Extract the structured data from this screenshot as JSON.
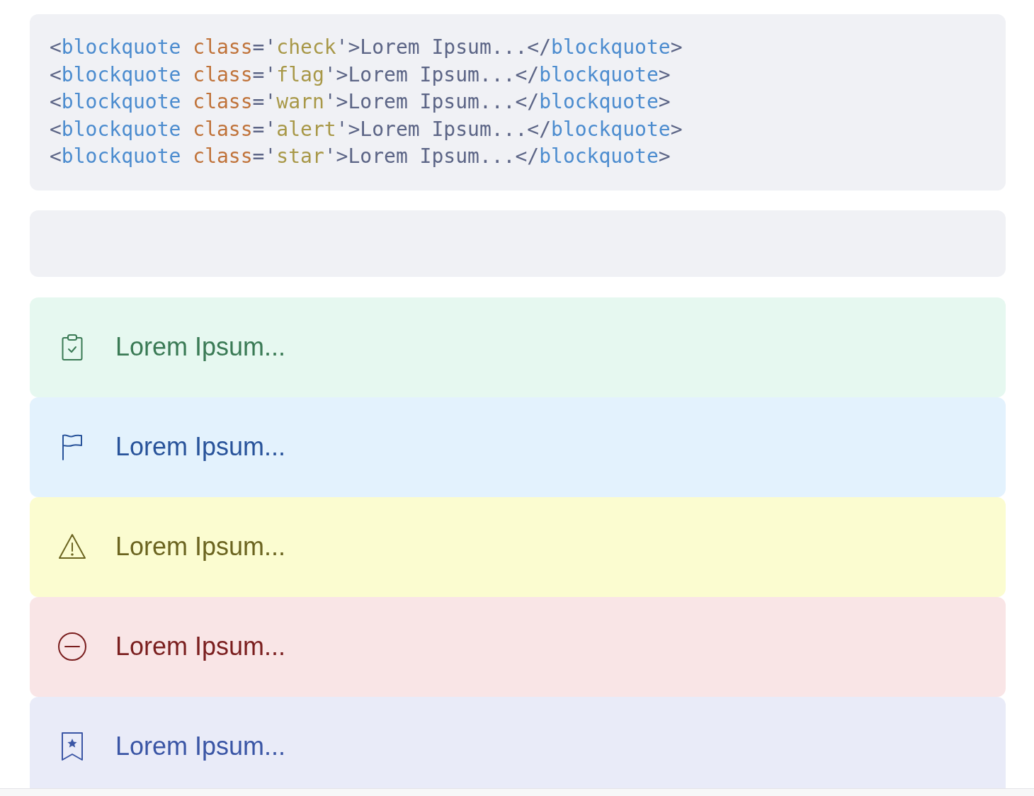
{
  "code_block": {
    "lines": [
      [
        {
          "kind": "punct",
          "text": "<"
        },
        {
          "kind": "tag",
          "text": "blockquote"
        },
        {
          "kind": "attr",
          "text": " class"
        },
        {
          "kind": "punct",
          "text": "='"
        },
        {
          "kind": "value",
          "text": "check"
        },
        {
          "kind": "punct",
          "text": "'>Lorem Ipsum...</"
        },
        {
          "kind": "tag",
          "text": "blockquote"
        },
        {
          "kind": "punct",
          "text": ">"
        }
      ],
      [
        {
          "kind": "punct",
          "text": "<"
        },
        {
          "kind": "tag",
          "text": "blockquote"
        },
        {
          "kind": "attr",
          "text": " class"
        },
        {
          "kind": "punct",
          "text": "='"
        },
        {
          "kind": "value",
          "text": "flag"
        },
        {
          "kind": "punct",
          "text": "'>Lorem Ipsum...</"
        },
        {
          "kind": "tag",
          "text": "blockquote"
        },
        {
          "kind": "punct",
          "text": ">"
        }
      ],
      [
        {
          "kind": "punct",
          "text": "<"
        },
        {
          "kind": "tag",
          "text": "blockquote"
        },
        {
          "kind": "attr",
          "text": " class"
        },
        {
          "kind": "punct",
          "text": "='"
        },
        {
          "kind": "value",
          "text": "warn"
        },
        {
          "kind": "punct",
          "text": "'>Lorem Ipsum...</"
        },
        {
          "kind": "tag",
          "text": "blockquote"
        },
        {
          "kind": "punct",
          "text": ">"
        }
      ],
      [
        {
          "kind": "punct",
          "text": "<"
        },
        {
          "kind": "tag",
          "text": "blockquote"
        },
        {
          "kind": "attr",
          "text": " class"
        },
        {
          "kind": "punct",
          "text": "='"
        },
        {
          "kind": "value",
          "text": "alert"
        },
        {
          "kind": "punct",
          "text": "'>Lorem Ipsum...</"
        },
        {
          "kind": "tag",
          "text": "blockquote"
        },
        {
          "kind": "punct",
          "text": ">"
        }
      ],
      [
        {
          "kind": "punct",
          "text": "<"
        },
        {
          "kind": "tag",
          "text": "blockquote"
        },
        {
          "kind": "attr",
          "text": " class"
        },
        {
          "kind": "punct",
          "text": "='"
        },
        {
          "kind": "value",
          "text": "star"
        },
        {
          "kind": "punct",
          "text": "'>Lorem Ipsum...</"
        },
        {
          "kind": "tag",
          "text": "blockquote"
        },
        {
          "kind": "punct",
          "text": ">"
        }
      ]
    ]
  },
  "callouts": [
    {
      "kind": "check",
      "text": "Lorem Ipsum..."
    },
    {
      "kind": "flag",
      "text": "Lorem Ipsum..."
    },
    {
      "kind": "warn",
      "text": "Lorem Ipsum..."
    },
    {
      "kind": "alert",
      "text": "Lorem Ipsum..."
    },
    {
      "kind": "star",
      "text": "Lorem Ipsum..."
    }
  ]
}
